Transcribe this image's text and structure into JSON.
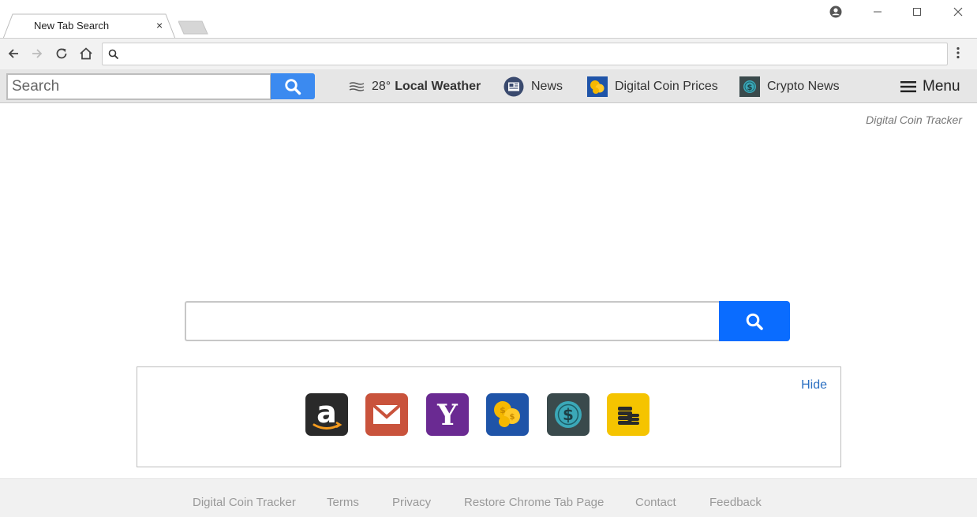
{
  "browser": {
    "tab_title": "New Tab Search",
    "tab_close": "×",
    "address_value": ""
  },
  "extension_bar": {
    "search_placeholder": "Search",
    "weather": {
      "temp": "28°",
      "label": "Local Weather"
    },
    "links": [
      "News",
      "Digital Coin Prices",
      "Crypto News"
    ],
    "menu_label": "Menu"
  },
  "main": {
    "brand": "Digital Coin Tracker",
    "search_value": "",
    "hide_label": "Hide",
    "tiles": [
      "amazon-icon",
      "gmail-icon",
      "yahoo-icon",
      "coins-icon",
      "dollar-coin-icon",
      "coin-stack-icon"
    ]
  },
  "footer": {
    "links": [
      "Digital Coin Tracker",
      "Terms",
      "Privacy",
      "Restore Chrome Tab Page",
      "Contact",
      "Feedback"
    ]
  },
  "colors": {
    "search_button": "#3b8af0",
    "main_search_button": "#0a6cff",
    "hide_link": "#2a6fc2"
  }
}
